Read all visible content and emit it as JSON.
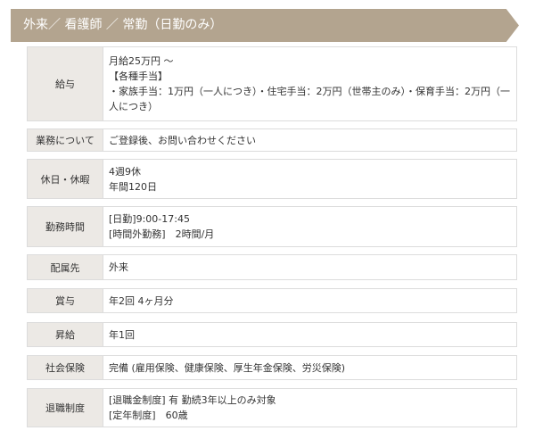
{
  "header": {
    "title": "外来／ 看護師 ／ 常勤（日勤のみ）"
  },
  "rows": [
    {
      "label": "給与",
      "lines": [
        "月給25万円 ～",
        "【各種手当】",
        "・家族手当：1万円（一人につき）・住宅手当：2万円（世帯主のみ）・保育手当：2万円（一人につき）"
      ]
    },
    {
      "label": "業務について",
      "lines": [
        "ご登録後、お問い合わせください"
      ]
    },
    {
      "label": "休日・休暇",
      "lines": [
        "4週9休",
        "年間120日"
      ]
    },
    {
      "label": "勤務時間",
      "lines": [
        "[日勤]9:00-17:45",
        "[時間外勤務]　2時間/月"
      ]
    },
    {
      "label": "配属先",
      "lines": [
        "外来"
      ]
    },
    {
      "label": "賞与",
      "lines": [
        "年2回 4ヶ月分"
      ]
    },
    {
      "label": "昇給",
      "lines": [
        "年1回"
      ]
    },
    {
      "label": "社会保険",
      "lines": [
        "完備 (雇用保険、健康保険、厚生年金保険、労災保険)"
      ]
    },
    {
      "label": "退職制度",
      "lines": [
        "[退職金制度] 有 勤続3年以上のみ対象",
        "[定年制度]　60歳"
      ]
    }
  ]
}
